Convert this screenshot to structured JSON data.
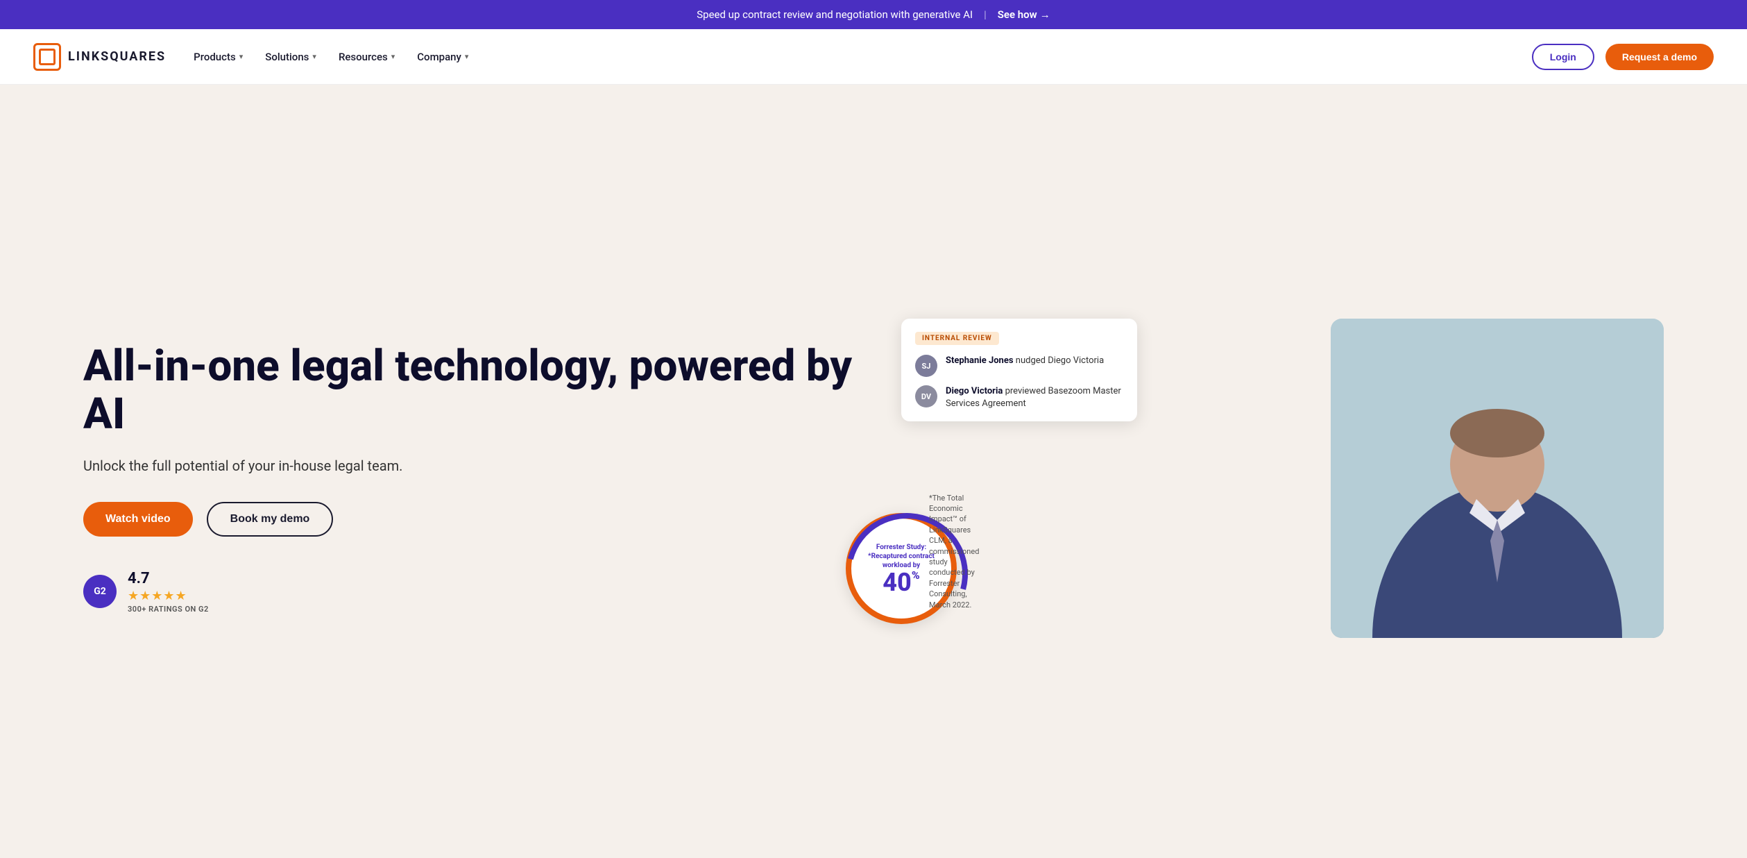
{
  "banner": {
    "text": "Speed up contract review and negotiation with generative AI",
    "separator": "|",
    "cta": "See how",
    "arrow": "→"
  },
  "navbar": {
    "logo_text": "LINKSQUARES",
    "nav_items": [
      {
        "label": "Products",
        "has_dropdown": true
      },
      {
        "label": "Solutions",
        "has_dropdown": true
      },
      {
        "label": "Resources",
        "has_dropdown": true
      },
      {
        "label": "Company",
        "has_dropdown": true
      }
    ],
    "login_label": "Login",
    "demo_label": "Request a demo"
  },
  "hero": {
    "title": "All-in-one legal technology, powered by AI",
    "subtitle": "Unlock the full potential of your in-house legal team.",
    "watch_video_label": "Watch video",
    "book_demo_label": "Book my demo",
    "rating": {
      "score": "4.7",
      "stars": "★★★★★",
      "count_label": "300+ RATINGS ON G2",
      "badge_text": "G2"
    }
  },
  "activity_card": {
    "tag": "INTERNAL REVIEW",
    "items": [
      {
        "initials": "SJ",
        "text_bold": "Stephanie Jones",
        "text_rest": " nudged Diego Victoria"
      },
      {
        "initials": "DV",
        "text_bold": "Diego Victoria",
        "text_rest": " previewed Basezoom Master Services Agreement"
      }
    ]
  },
  "forrester": {
    "label_line1": "Forrester Study:",
    "label_line2": "*Recaptured contract workload by",
    "percentage": "40",
    "percent_sign": "%",
    "note": "*The Total Economic Impact™ of LinkSquares CLM, a commissioned study conducted by Forrester Consulting, March 2022."
  }
}
